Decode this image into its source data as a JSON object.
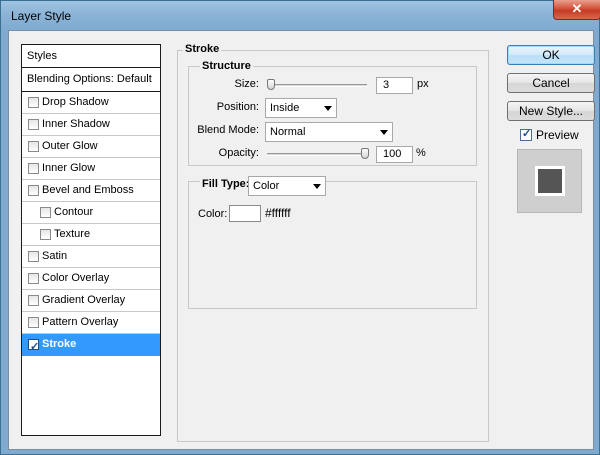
{
  "window": {
    "title": "Layer Style",
    "close_glyph": "✕"
  },
  "styles_list": {
    "header": "Styles",
    "blending_options": "Blending Options: Default",
    "items": [
      {
        "label": "Drop Shadow",
        "checked": false,
        "indent": false
      },
      {
        "label": "Inner Shadow",
        "checked": false,
        "indent": false
      },
      {
        "label": "Outer Glow",
        "checked": false,
        "indent": false
      },
      {
        "label": "Inner Glow",
        "checked": false,
        "indent": false
      },
      {
        "label": "Bevel and Emboss",
        "checked": false,
        "indent": false
      },
      {
        "label": "Contour",
        "checked": false,
        "indent": true
      },
      {
        "label": "Texture",
        "checked": false,
        "indent": true
      },
      {
        "label": "Satin",
        "checked": false,
        "indent": false
      },
      {
        "label": "Color Overlay",
        "checked": false,
        "indent": false
      },
      {
        "label": "Gradient Overlay",
        "checked": false,
        "indent": false
      },
      {
        "label": "Pattern Overlay",
        "checked": false,
        "indent": false
      },
      {
        "label": "Stroke",
        "checked": true,
        "indent": false,
        "selected": true
      }
    ]
  },
  "stroke": {
    "group_title": "Stroke",
    "structure_title": "Structure",
    "size": {
      "label": "Size:",
      "value": "3",
      "unit": "px",
      "slider_fraction": 0.0
    },
    "position": {
      "label": "Position:",
      "value": "Inside"
    },
    "blend_mode": {
      "label": "Blend Mode:",
      "value": "Normal"
    },
    "opacity": {
      "label": "Opacity:",
      "value": "100",
      "unit": "%",
      "slider_fraction": 1.0
    },
    "fill_type": {
      "label": "Fill Type:",
      "value": "Color"
    },
    "color": {
      "label": "Color:",
      "hex_text": "#ffffff",
      "swatch": "#ffffff"
    }
  },
  "buttons": {
    "ok": "OK",
    "cancel": "Cancel",
    "new_style": "New Style..."
  },
  "preview": {
    "label": "Preview",
    "checked": true
  }
}
